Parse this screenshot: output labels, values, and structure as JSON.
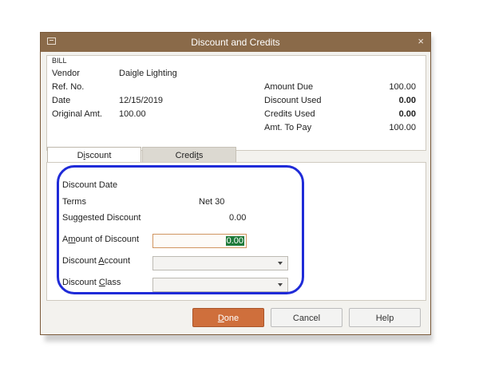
{
  "window": {
    "title": "Discount and Credits",
    "close_glyph": "×",
    "system_icon": "window-menu-icon"
  },
  "bill": {
    "section_label": "BILL",
    "vendor_label": "Vendor",
    "vendor_value": "Daigle Lighting",
    "refno_label": "Ref. No.",
    "date_label": "Date",
    "date_value": "12/15/2019",
    "original_label": "Original Amt.",
    "original_value": "100.00",
    "amount_due_label": "Amount Due",
    "amount_due_value": "100.00",
    "discount_used_label": "Discount Used",
    "discount_used_value": "0.00",
    "credits_used_label": "Credits Used",
    "credits_used_value": "0.00",
    "amt_to_pay_label": "Amt. To Pay",
    "amt_to_pay_value": "100.00"
  },
  "tabs": {
    "discount": {
      "pre": "D",
      "key": "i",
      "post": "scount"
    },
    "credits": {
      "pre": "Credi",
      "key": "t",
      "post": "s"
    }
  },
  "discount": {
    "date_label": "Discount Date",
    "terms_label": "Terms",
    "terms_value": "Net 30",
    "suggested_label": "Suggested Discount",
    "suggested_value": "0.00",
    "amount_label": {
      "pre": "A",
      "key": "m",
      "post": "ount of Discount"
    },
    "amount_value": "0.00",
    "account_label": {
      "pre": "Discount ",
      "key": "A",
      "post": "ccount"
    },
    "class_label": {
      "pre": "Discount ",
      "key": "C",
      "post": "lass"
    },
    "account_value": "",
    "class_value": ""
  },
  "buttons": {
    "done": {
      "key": "D",
      "post": "one"
    },
    "cancel": "Cancel",
    "help": "Help"
  },
  "colors": {
    "titlebar": "#8a6a49",
    "done_button": "#cf6f3c",
    "highlight_circle": "#1f2bd8",
    "selection": "#1e7a3a"
  }
}
